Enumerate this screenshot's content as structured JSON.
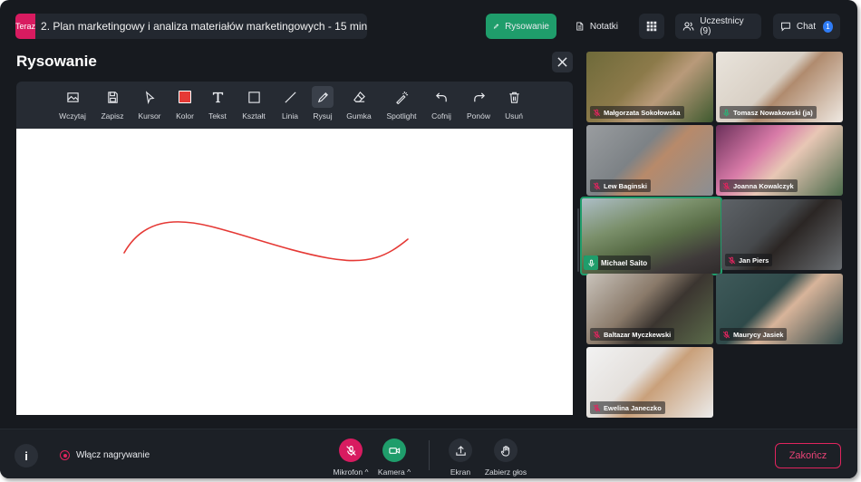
{
  "header": {
    "now_badge": "Teraz",
    "agenda_title": "2. Plan marketingowy i analiza materiałów marketingowych - 15 min",
    "draw_label": "Rysowanie",
    "notes_label": "Notatki",
    "participants_label": "Uczestnicy (9)",
    "chat_label": "Chat",
    "chat_count": "1"
  },
  "panel": {
    "title": "Rysowanie",
    "tools": [
      {
        "label": "Wczytaj",
        "icon": "image-icon"
      },
      {
        "label": "Zapisz",
        "icon": "save-icon"
      },
      {
        "label": "Kursor",
        "icon": "cursor-icon"
      },
      {
        "label": "Kolor",
        "icon": "color-swatch"
      },
      {
        "label": "Tekst",
        "icon": "text-icon"
      },
      {
        "label": "Kształt",
        "icon": "shape-icon"
      },
      {
        "label": "Linia",
        "icon": "line-icon"
      },
      {
        "label": "Rysuj",
        "icon": "pencil-icon"
      },
      {
        "label": "Gumka",
        "icon": "eraser-icon"
      },
      {
        "label": "Spotlight",
        "icon": "wand-icon"
      },
      {
        "label": "Cofnij",
        "icon": "undo-icon"
      },
      {
        "label": "Ponów",
        "icon": "redo-icon"
      },
      {
        "label": "Usuń",
        "icon": "trash-icon"
      }
    ],
    "active_tool": "Rysuj",
    "selected_color": "#e53935",
    "stroke_color": "#e53935"
  },
  "participants": [
    {
      "name": "Małgorzata Sokołowska",
      "muted": true
    },
    {
      "name": "Tomasz Nowakowski (ja)",
      "muted": false
    },
    {
      "name": "Lew Baginski",
      "muted": true
    },
    {
      "name": "Joanna Kowalczyk",
      "muted": true
    },
    {
      "name": "Michael Saito",
      "muted": false,
      "speaking": true
    },
    {
      "name": "Jan Piers",
      "muted": true
    },
    {
      "name": "Baltazar Myczkewski",
      "muted": true
    },
    {
      "name": "Maurycy Jasiek",
      "muted": true
    },
    {
      "name": "Ewelina Janeczko",
      "muted": true
    }
  ],
  "bottom": {
    "recording_label": "Włącz nagrywanie",
    "mic_label": "Mikrofon",
    "camera_label": "Kamera",
    "screen_label": "Ekran",
    "raise_hand_label": "Zabierz głos",
    "end_label": "Zakończ"
  },
  "colors": {
    "accent_green": "#1f9d6b",
    "danger_pink": "#e0245e",
    "mic_off_bg": "#d81b60",
    "chat_badge": "#2f7cf6"
  }
}
